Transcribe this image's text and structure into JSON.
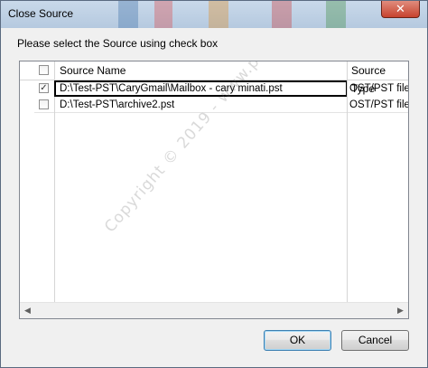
{
  "window": {
    "title": "Close Source",
    "close_glyph": "✕"
  },
  "dialog": {
    "instruction": "Please select the Source using check box"
  },
  "list": {
    "columns": [
      "Source Name",
      "Source Type"
    ],
    "rows": [
      {
        "checked": true,
        "source_name": "D:\\Test-PST\\CaryGmail\\Mailbox - cary minati.pst",
        "source_type": "OST/PST file..."
      },
      {
        "checked": false,
        "source_name": "D:\\Test-PST\\archive2.pst",
        "source_type": "OST/PST file..."
      }
    ],
    "scroll_left_glyph": "◀",
    "scroll_right_glyph": "▶"
  },
  "watermark": "Copyright © 2019 - www.p30download.com",
  "buttons": {
    "ok": "OK",
    "cancel": "Cancel"
  },
  "icons": {
    "close": "close-icon",
    "checkbox_checked": "✓"
  },
  "colors": {
    "titlebar": "#c9d9ea",
    "close_button": "#c7432e",
    "selection_border": "#000000",
    "default_button_border": "#3c7fb1"
  }
}
